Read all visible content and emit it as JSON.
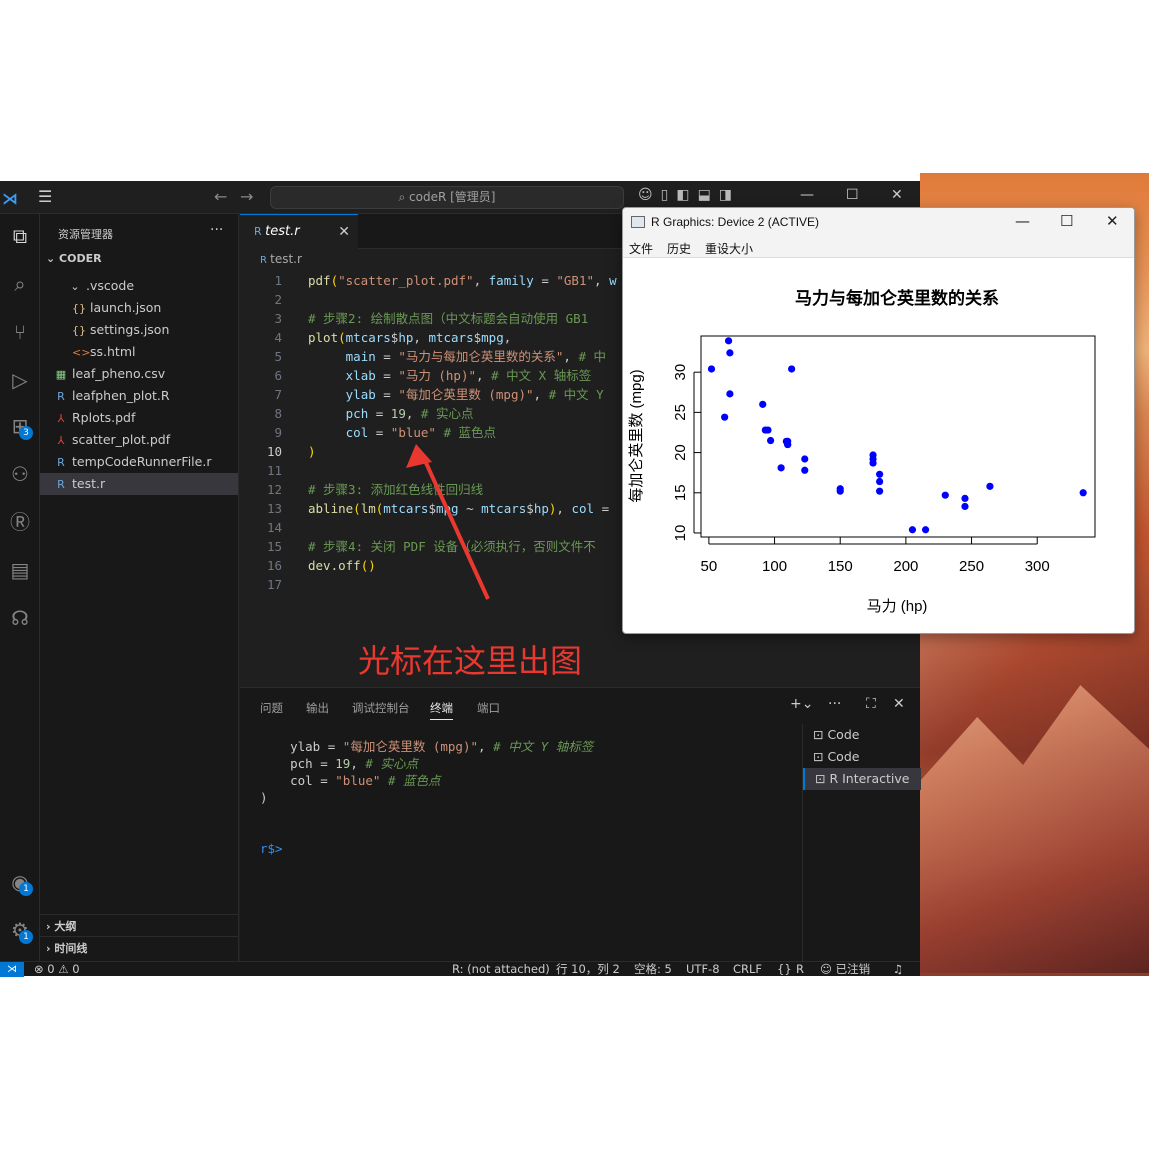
{
  "titlebar": {
    "search_text": "codeR [管理员]"
  },
  "activity": {
    "source_control_badge": "",
    "extensions_badge": "3",
    "accounts_badge": "1",
    "manage_badge": "1"
  },
  "sidebar": {
    "title": "资源管理器",
    "more": "···",
    "folder": "CODER",
    "items": [
      {
        "label": ".vscode",
        "icon": "chevron-down-icon",
        "glyph": "⌄"
      },
      {
        "label": "launch.json",
        "icon": "json-icon",
        "glyph": "{}"
      },
      {
        "label": "settings.json",
        "icon": "json-icon",
        "glyph": "{}"
      },
      {
        "label": "ss.html",
        "icon": "html-icon",
        "glyph": "<>"
      },
      {
        "label": "leaf_pheno.csv",
        "icon": "csv-icon",
        "glyph": "▦"
      },
      {
        "label": "leafphen_plot.R",
        "icon": "r-file-icon",
        "glyph": "R"
      },
      {
        "label": "Rplots.pdf",
        "icon": "pdf-icon",
        "glyph": "⅄"
      },
      {
        "label": "scatter_plot.pdf",
        "icon": "pdf-icon",
        "glyph": "⅄"
      },
      {
        "label": "tempCodeRunnerFile.r",
        "icon": "r-file-icon",
        "glyph": "R"
      },
      {
        "label": "test.r",
        "icon": "r-file-icon",
        "glyph": "R"
      }
    ],
    "outline": "大纲",
    "timeline": "时间线"
  },
  "editor": {
    "tab_label": "test.r",
    "breadcrumb": "test.r",
    "current_line": 10,
    "lines": [
      "pdf(\"scatter_plot.pdf\", family = \"GB1\", w",
      "",
      "# 步骤2: 绘制散点图（中文标题会自动使用 GB1",
      "plot(mtcars$hp, mtcars$mpg,",
      "     main = \"马力与每加仑英里数的关系\", # 中",
      "     xlab = \"马力 (hp)\", # 中文 X 轴标签",
      "     ylab = \"每加仑英里数 (mpg)\", # 中文 Y",
      "     pch = 19, # 实心点",
      "     col = \"blue\" # 蓝色点",
      ")",
      "",
      "# 步骤3: 添加红色线性回归线",
      "abline(lm(mtcars$mpg ~ mtcars$hp), col =",
      "",
      "# 步骤4: 关闭 PDF 设备（必须执行，否则文件不",
      "dev.off()",
      ""
    ],
    "annotation": "光标在这里出图"
  },
  "panel": {
    "tabs": [
      "问题",
      "输出",
      "调试控制台",
      "终端",
      "端口"
    ],
    "active_tab": "终端",
    "terminal_lines": [
      "    ylab = \"每加仑英里数 (mpg)\", # 中文 Y 轴标签",
      "    pch = 19, # 实心点",
      "    col = \"blue\" # 蓝色点",
      ")",
      "",
      "r$>"
    ],
    "terminals": [
      "Code",
      "Code",
      "R Interactive"
    ]
  },
  "statusbar": {
    "problems": "⊗ 0 ⚠ 0",
    "r_status": "R: (not attached)",
    "position": "行 10，列 2",
    "spaces": "空格: 5",
    "encoding": "UTF-8",
    "eol": "CRLF",
    "language": "R",
    "account": "已注销"
  },
  "rwindow": {
    "title": "R Graphics: Device 2 (ACTIVE)",
    "menu": [
      "文件",
      "历史",
      "重设大小"
    ]
  },
  "chart_data": {
    "type": "scatter",
    "title": "马力与每加仑英里数的关系",
    "xlabel": "马力 (hp)",
    "ylabel": "每加仑英里数 (mpg)",
    "xlim": [
      44,
      344
    ],
    "ylim": [
      9.5,
      34.5
    ],
    "xticks": [
      50,
      100,
      150,
      200,
      250,
      300
    ],
    "yticks": [
      10,
      15,
      20,
      25,
      30
    ],
    "point_color": "#0000ff",
    "grid": false,
    "x": [
      110,
      110,
      93,
      110,
      175,
      105,
      245,
      62,
      95,
      123,
      123,
      180,
      180,
      180,
      205,
      215,
      230,
      66,
      52,
      65,
      97,
      150,
      150,
      245,
      175,
      66,
      91,
      113,
      264,
      175,
      335,
      109
    ],
    "y": [
      21.0,
      21.0,
      22.8,
      21.4,
      18.7,
      18.1,
      14.3,
      24.4,
      22.8,
      19.2,
      17.8,
      16.4,
      17.3,
      15.2,
      10.4,
      10.4,
      14.7,
      32.4,
      30.4,
      33.9,
      21.5,
      15.5,
      15.2,
      13.3,
      19.2,
      27.3,
      26.0,
      30.4,
      15.8,
      19.7,
      15.0,
      21.4
    ]
  }
}
